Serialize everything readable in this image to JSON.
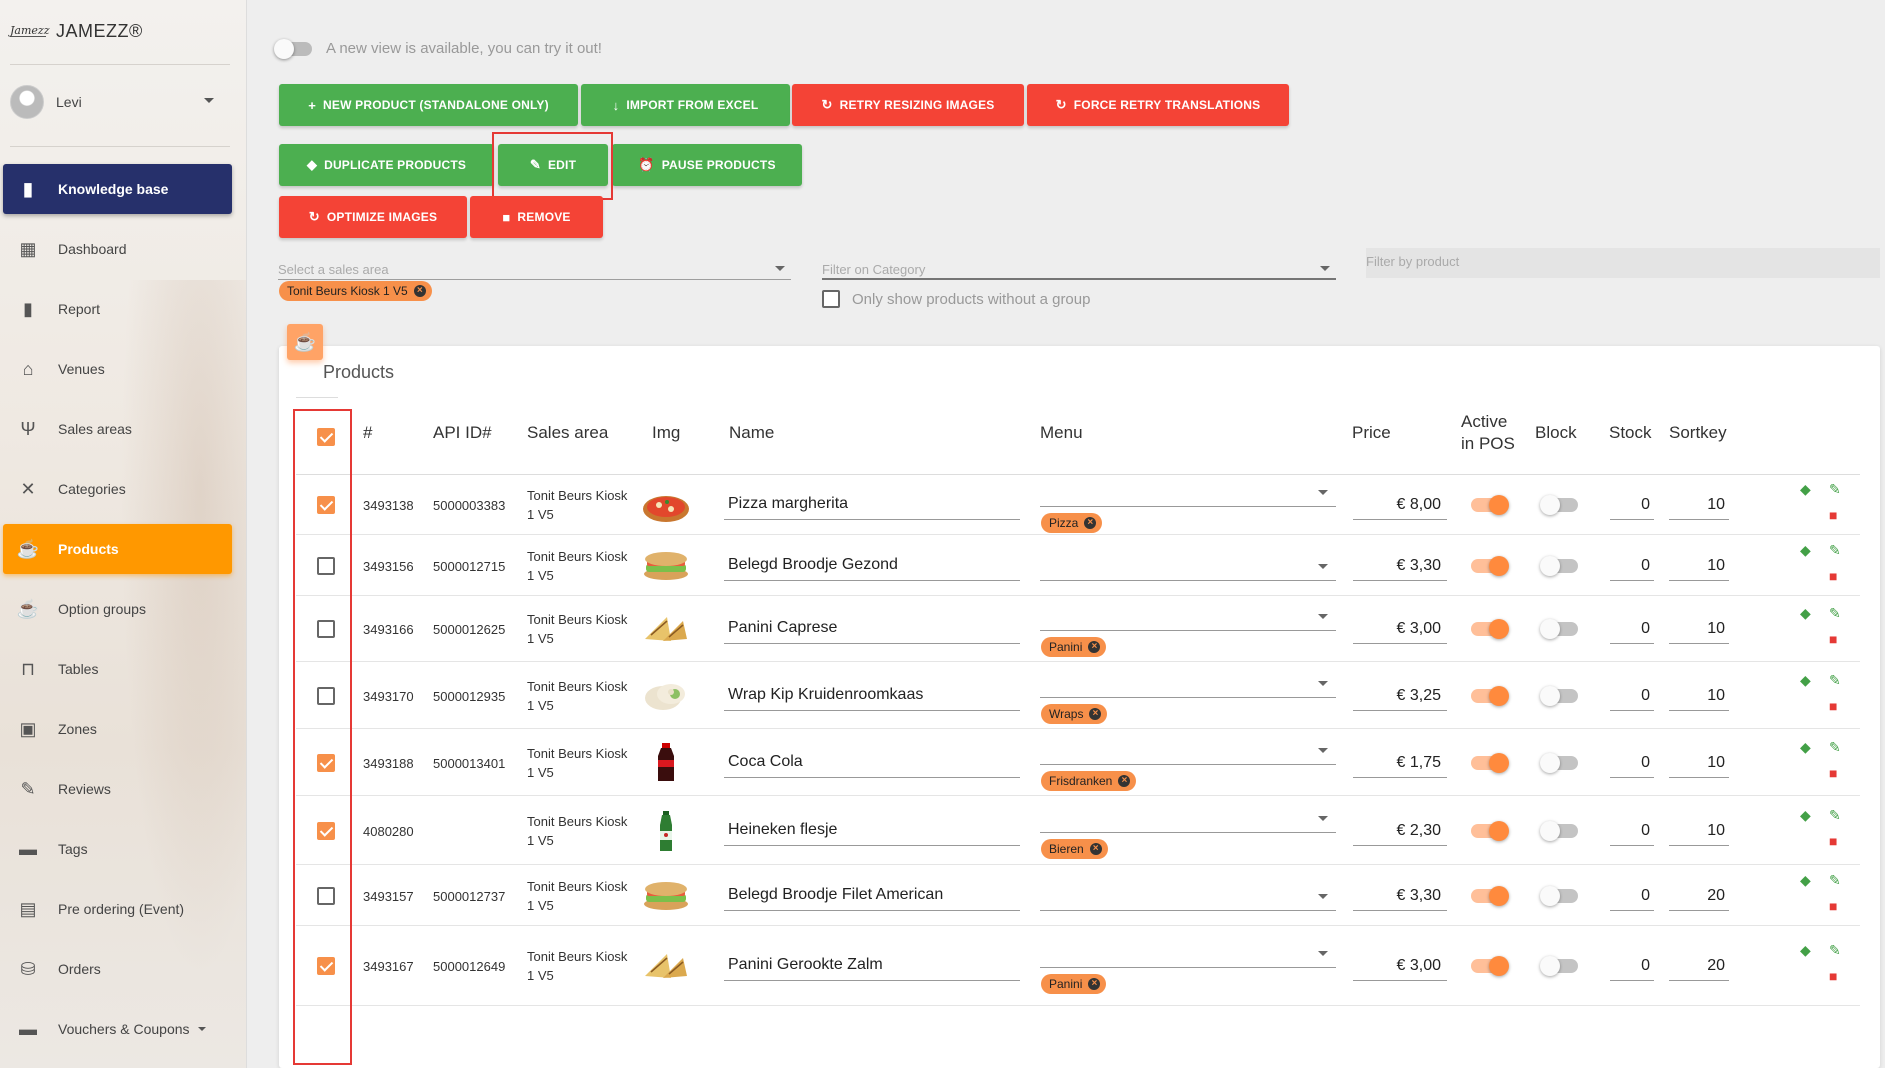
{
  "app": {
    "logo_text": "Jamezz",
    "name": "JAMEZZ®"
  },
  "user": {
    "name": "Levi"
  },
  "sidebar": {
    "items": [
      {
        "label": "Knowledge base",
        "icon": "book-icon",
        "glyph": "▮"
      },
      {
        "label": "Dashboard",
        "icon": "dashboard-icon",
        "glyph": "▦"
      },
      {
        "label": "Report",
        "icon": "bar-chart-icon",
        "glyph": "▮"
      },
      {
        "label": "Venues",
        "icon": "home-icon",
        "glyph": "⌂"
      },
      {
        "label": "Sales areas",
        "icon": "restaurant-icon",
        "glyph": "Ψ"
      },
      {
        "label": "Categories",
        "icon": "utensils-cross-icon",
        "glyph": "✕"
      },
      {
        "label": "Products",
        "icon": "coffee-icon",
        "glyph": "☕"
      },
      {
        "label": "Option groups",
        "icon": "coffee-icon",
        "glyph": "☕"
      },
      {
        "label": "Tables",
        "icon": "table-icon",
        "glyph": "⊓"
      },
      {
        "label": "Zones",
        "icon": "zones-icon",
        "glyph": "▣"
      },
      {
        "label": "Reviews",
        "icon": "rate-review-icon",
        "glyph": "✎"
      },
      {
        "label": "Tags",
        "icon": "label-icon",
        "glyph": "▬"
      },
      {
        "label": "Pre ordering (Event)",
        "icon": "calendar-icon",
        "glyph": "▤"
      },
      {
        "label": "Orders",
        "icon": "shopping-basket-icon",
        "glyph": "⛁"
      },
      {
        "label": "Vouchers & Coupons",
        "icon": "voucher-icon",
        "glyph": "▬"
      }
    ]
  },
  "notice": {
    "text": "A new view is available, you can try it out!"
  },
  "toolbar": {
    "new_product": "NEW PRODUCT (STANDALONE ONLY)",
    "import_excel": "IMPORT FROM EXCEL",
    "retry_resizing": "RETRY RESIZING IMAGES",
    "force_retry": "FORCE RETRY TRANSLATIONS",
    "duplicate": "DUPLICATE PRODUCTS",
    "edit": "EDIT",
    "pause": "PAUSE PRODUCTS",
    "optimize": "OPTIMIZE IMAGES",
    "remove": "REMOVE"
  },
  "filters": {
    "sales_area_placeholder": "Select a sales area",
    "sales_area_chip": "Tonit Beurs Kiosk 1 V5",
    "category_placeholder": "Filter on Category",
    "product_placeholder": "Filter by product",
    "no_group_label": "Only show products without a group"
  },
  "table": {
    "title": "Products",
    "headers": {
      "id": "#",
      "api": "API ID#",
      "area": "Sales area",
      "img": "Img",
      "name": "Name",
      "menu": "Menu",
      "price": "Price",
      "active1": "Active",
      "active2": "in POS",
      "block": "Block",
      "stock": "Stock",
      "sortkey": "Sortkey"
    },
    "rows": [
      {
        "checked": true,
        "id": "3493138",
        "api": "5000003383",
        "area1": "Tonit Beurs Kiosk",
        "area2": "1 V5",
        "image": "pizza",
        "name": "Pizza margherita",
        "menu": "Pizza",
        "price": "€ 8,00",
        "active": true,
        "block": false,
        "stock": "0",
        "sortkey": "10"
      },
      {
        "checked": false,
        "id": "3493156",
        "api": "5000012715",
        "area1": "Tonit Beurs Kiosk",
        "area2": "1 V5",
        "image": "sandwich",
        "name": "Belegd Broodje Gezond",
        "menu": "",
        "price": "€ 3,30",
        "active": true,
        "block": false,
        "stock": "0",
        "sortkey": "10"
      },
      {
        "checked": false,
        "id": "3493166",
        "api": "5000012625",
        "area1": "Tonit Beurs Kiosk",
        "area2": "1 V5",
        "image": "panini",
        "name": "Panini Caprese",
        "menu": "Panini",
        "price": "€ 3,00",
        "active": true,
        "block": false,
        "stock": "0",
        "sortkey": "10"
      },
      {
        "checked": false,
        "id": "3493170",
        "api": "5000012935",
        "area1": "Tonit Beurs Kiosk",
        "area2": "1 V5",
        "image": "wrap",
        "name": "Wrap Kip Kruidenroomkaas",
        "menu": "Wraps",
        "price": "€ 3,25",
        "active": true,
        "block": false,
        "stock": "0",
        "sortkey": "10"
      },
      {
        "checked": true,
        "id": "3493188",
        "api": "5000013401",
        "area1": "Tonit Beurs Kiosk",
        "area2": "1 V5",
        "image": "cola",
        "name": "Coca Cola",
        "menu": "Frisdranken",
        "price": "€ 1,75",
        "active": true,
        "block": false,
        "stock": "0",
        "sortkey": "10"
      },
      {
        "checked": true,
        "id": "4080280",
        "api": "",
        "area1": "Tonit Beurs Kiosk",
        "area2": "1 V5",
        "image": "beer",
        "name": "Heineken flesje",
        "menu": "Bieren",
        "price": "€ 2,30",
        "active": true,
        "block": false,
        "stock": "0",
        "sortkey": "10"
      },
      {
        "checked": false,
        "id": "3493157",
        "api": "5000012737",
        "area1": "Tonit Beurs Kiosk",
        "area2": "1 V5",
        "image": "sandwich",
        "name": "Belegd Broodje Filet American",
        "menu": "",
        "price": "€ 3,30",
        "active": true,
        "block": false,
        "stock": "0",
        "sortkey": "20"
      },
      {
        "checked": true,
        "id": "3493167",
        "api": "5000012649",
        "area1": "Tonit Beurs Kiosk",
        "area2": "1 V5",
        "image": "panini",
        "name": "Panini Gerookte Zalm",
        "menu": "Panini",
        "price": "€ 3,00",
        "active": true,
        "block": false,
        "stock": "0",
        "sortkey": "20"
      }
    ]
  },
  "colors": {
    "green": "#4caf50",
    "red": "#f44336",
    "orange": "#ff9800",
    "navy": "#26306b",
    "chip": "#f7904a"
  }
}
